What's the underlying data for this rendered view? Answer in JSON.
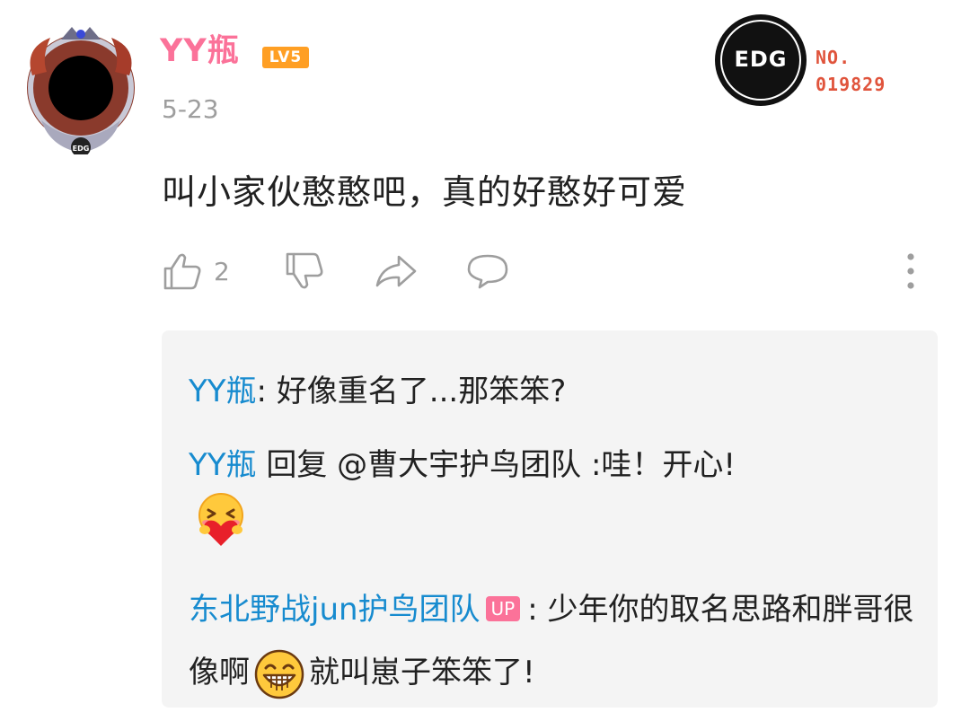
{
  "author": {
    "name": "YY瓶",
    "level": "LV5",
    "date": "5-23"
  },
  "fan_medal": {
    "logo": "EDG",
    "label": "NO.",
    "number": "019829"
  },
  "comment": {
    "text": "叫小家伙憨憨吧，真的好憨好可爱"
  },
  "actions": {
    "like_count": "2"
  },
  "replies": [
    {
      "name": "YY瓶",
      "sep": ": ",
      "text": "好像重名了...那笨笨?"
    },
    {
      "name": "YY瓶",
      "text": " 回复 @曹大宇护鸟团队 :哇！开心!"
    },
    {
      "name": "东北野战jun护鸟团队",
      "badge": "UP",
      "text_a": ": 少年你的取名思路和胖哥很像啊",
      "text_b": "就叫崽子笨笨了!"
    }
  ],
  "colors": {
    "username": "#fb7299",
    "level_badge": "#ff9f24",
    "reply_name": "#178bcf",
    "up_badge": "#fb7299",
    "fan_number": "#e0543c",
    "muted": "#9e9e9e"
  },
  "icons": [
    "thumbs-up-icon",
    "thumbs-down-icon",
    "share-icon",
    "reply-icon",
    "more-icon",
    "hug-emoji",
    "grin-emoji"
  ]
}
